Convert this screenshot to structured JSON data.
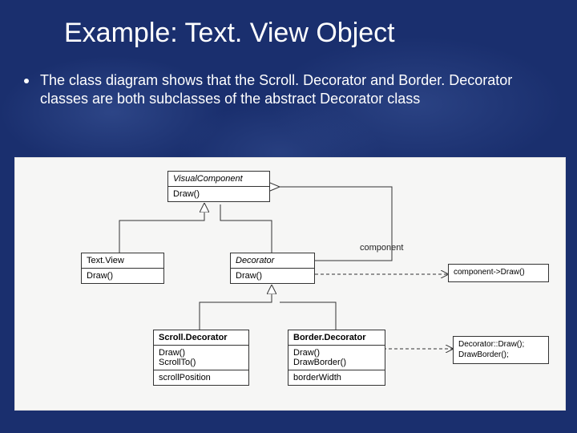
{
  "slide": {
    "title": "Example:  Text. View Object",
    "bullet1": "The class diagram shows that the Scroll. Decorator and Border. Decorator classes are both subclasses of the abstract Decorator class"
  },
  "diagram": {
    "visualComponent": {
      "name": "VisualComponent",
      "method": "Draw()"
    },
    "textView": {
      "name": "Text.View",
      "method": "Draw()"
    },
    "decorator": {
      "name": "Decorator",
      "method": "Draw()",
      "assocLabel": "component"
    },
    "scrollDecorator": {
      "name": "Scroll.Decorator",
      "methods": "Draw()\nScrollTo()",
      "attrs": "scrollPosition"
    },
    "borderDecorator": {
      "name": "Border.Decorator",
      "methods": "Draw()\nDrawBorder()",
      "attrs": "borderWidth"
    },
    "noteDecoratorDraw": "component->Draw()",
    "noteBorderDraw": "Decorator::Draw();\nDrawBorder();"
  }
}
